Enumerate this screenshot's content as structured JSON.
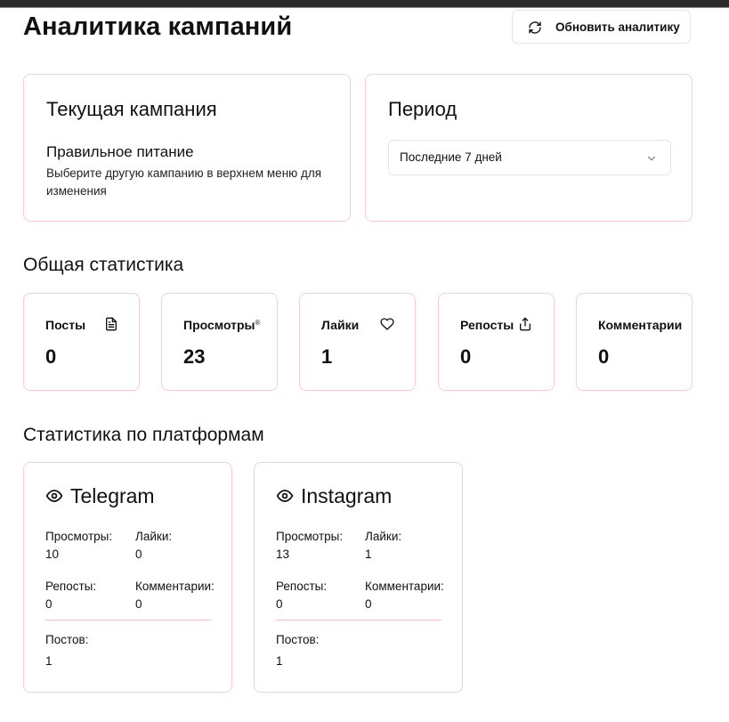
{
  "header": {
    "title": "Аналитика кампаний",
    "refresh_label": "Обновить аналитику",
    "refresh_icon": "refresh-icon"
  },
  "campaign": {
    "heading": "Текущая кампания",
    "name": "Правильное питание",
    "hint": "Выберите другую кампанию в верхнем меню для изменения"
  },
  "period": {
    "heading": "Период",
    "selected": "Последние 7 дней"
  },
  "overall": {
    "title": "Общая статистика",
    "stats": [
      {
        "label": "Посты",
        "value": "0",
        "icon": "document-icon"
      },
      {
        "label": "Просмотры",
        "mark": "®",
        "value": "23",
        "icon": "eye-icon"
      },
      {
        "label": "Лайки",
        "value": "1",
        "icon": "heart-icon"
      },
      {
        "label": "Репосты",
        "value": "0",
        "icon": "share-icon"
      },
      {
        "label": "Комментарии",
        "value": "0",
        "icon": "comment-icon"
      }
    ]
  },
  "platforms": {
    "title": "Статистика по платформам",
    "labels": {
      "views": "Просмотры:",
      "likes": "Лайки:",
      "reposts": "Репосты:",
      "comments": "Комментарии:",
      "posts": "Постов:"
    },
    "items": [
      {
        "name": "Telegram",
        "icon": "eye-icon",
        "views": "10",
        "likes": "0",
        "reposts": "0",
        "comments": "0",
        "posts": "1"
      },
      {
        "name": "Instagram",
        "icon": "eye-icon",
        "views": "13",
        "likes": "1",
        "reposts": "0",
        "comments": "0",
        "posts": "1"
      }
    ]
  },
  "colors": {
    "card_border": "#f6cdd5",
    "button_border": "#e4e4e7",
    "text": "#111111"
  }
}
